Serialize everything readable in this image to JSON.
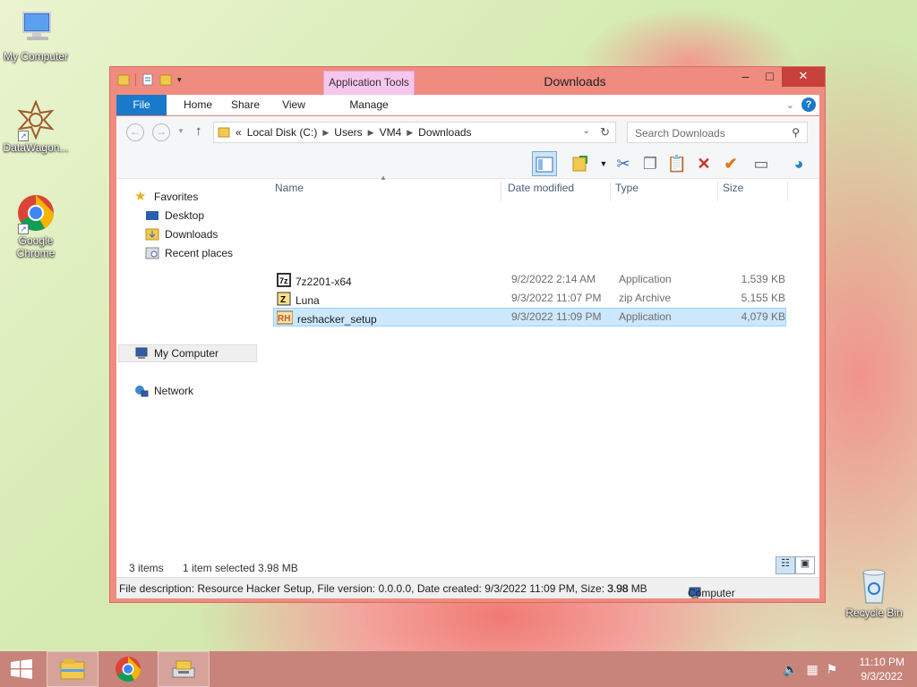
{
  "desktop": {
    "icons": [
      {
        "label": "My Computer"
      },
      {
        "label": "DataWagon..."
      },
      {
        "label": "Google Chrome"
      },
      {
        "label": "Recycle Bin"
      }
    ]
  },
  "window": {
    "title": "Downloads",
    "context_tab": "Application Tools",
    "tabs": {
      "file": "File",
      "home": "Home",
      "share": "Share",
      "view": "View",
      "manage": "Manage"
    },
    "buttons": {
      "minimize": "–",
      "maximize": "□",
      "close": "✕"
    },
    "address": {
      "prefix": "«",
      "segments": [
        "Local Disk (C:)",
        "Users",
        "VM4",
        "Downloads"
      ]
    },
    "search_placeholder": "Search Downloads",
    "nav": {
      "favorites": "Favorites",
      "desktop": "Desktop",
      "downloads": "Downloads",
      "recent": "Recent places",
      "computer": "My Computer",
      "network": "Network"
    },
    "columns": {
      "name": "Name",
      "date": "Date modified",
      "type": "Type",
      "size": "Size"
    },
    "files": [
      {
        "name": "7z2201-x64",
        "date": "9/2/2022 2:14 AM",
        "type": "Application",
        "size": "1,539 KB",
        "icon_color": "#333333"
      },
      {
        "name": "Luna",
        "date": "9/3/2022 11:07 PM",
        "type": "zip Archive",
        "size": "5,155 KB",
        "icon_color": "#e0b43c"
      },
      {
        "name": "reshacker_setup",
        "date": "9/3/2022 11:09 PM",
        "type": "Application",
        "size": "4,079 KB",
        "icon_color": "#c85a1e"
      }
    ],
    "status": {
      "items": "3 items",
      "selected": "1 item selected  3.98 MB"
    },
    "infobar": {
      "description": "File description: Resource Hacker Setup, File version: 0.0.0.0, Date created: 9/3/2022 11:09 PM, Size: 3.98",
      "size": "3.98 MB",
      "location": "Computer"
    }
  },
  "taskbar": {
    "time": "11:10 PM",
    "date": "9/3/2022"
  },
  "colors": {
    "accent": "#1979ca",
    "window_frame": "#f08b80",
    "selection": "#cce8ff"
  }
}
